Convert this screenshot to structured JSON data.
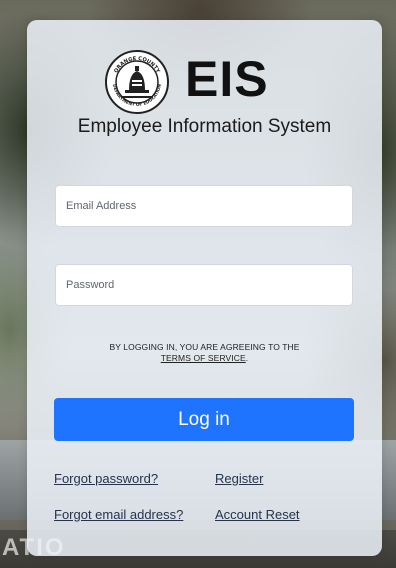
{
  "background": {
    "sign_text": "ATIO"
  },
  "brand": {
    "seal_name": "orange-county-department-of-education-seal",
    "seal_top_text": "ORANGE COUNTY",
    "seal_bottom_text": "DEPARTMENT OF EDUCATION",
    "wordmark": "EIS",
    "subtitle": "Employee Information System"
  },
  "form": {
    "email_placeholder": "Email Address",
    "password_placeholder": "Password",
    "terms_line1": "BY LOGGING IN, YOU ARE AGREEING TO THE",
    "terms_link": "TERMS OF SERVICE",
    "terms_suffix": ".",
    "login_label": "Log in"
  },
  "links": {
    "forgot_password": "Forgot password?",
    "register": "Register",
    "forgot_email": "Forgot email address?",
    "account_reset": "Account Reset"
  },
  "colors": {
    "primary_button": "#1e74ff",
    "card_background": "#ecf2f9"
  }
}
